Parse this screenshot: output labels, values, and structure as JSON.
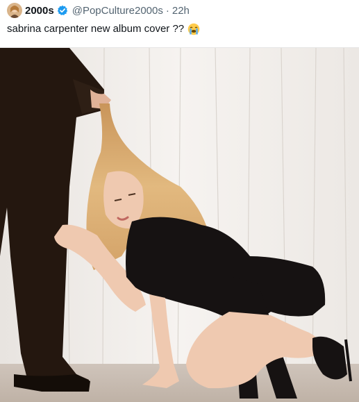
{
  "tweet": {
    "author": {
      "display_name": "2000s",
      "handle": "@PopCulture2000s",
      "verified": true,
      "verified_icon": "verified-badge-icon",
      "avatar_icon": "avatar-photo"
    },
    "separator": "·",
    "time": "22h",
    "text": "sabrina carpenter new album cover ??",
    "emoji": "loudly-crying-face-icon",
    "media": {
      "type": "photo",
      "subject": "photo"
    }
  },
  "colors": {
    "text": "#0f1419",
    "secondary": "#536471",
    "verified": "#1d9bf0"
  }
}
